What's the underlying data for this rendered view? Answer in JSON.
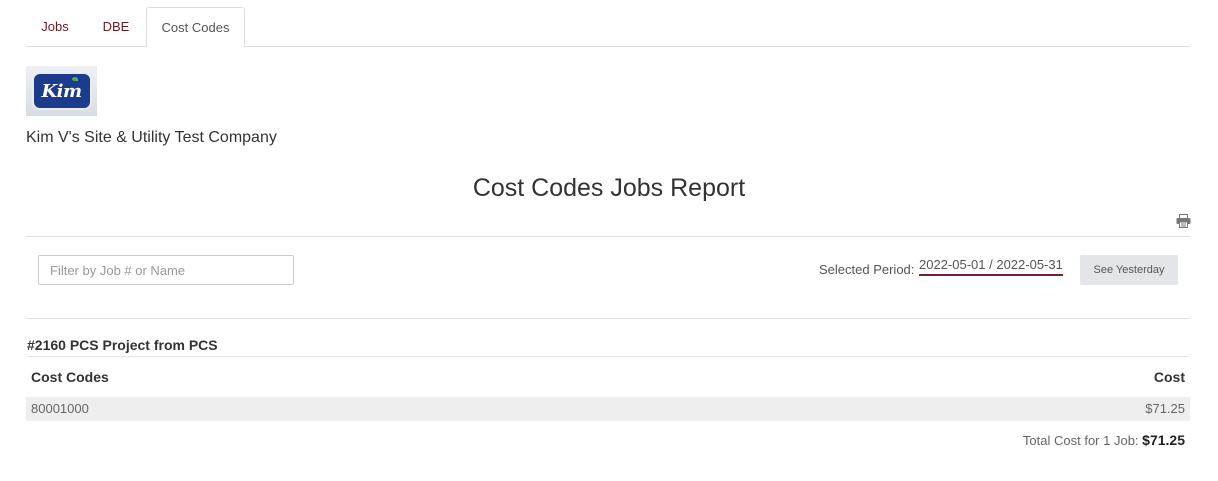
{
  "tabs": [
    {
      "label": "Jobs"
    },
    {
      "label": "DBE"
    },
    {
      "label": "Cost Codes"
    }
  ],
  "active_tab": "Cost Codes",
  "company": {
    "logo_text": "Kim",
    "name": "Kim V's Site & Utility Test Company"
  },
  "report": {
    "title": "Cost Codes Jobs Report"
  },
  "filter": {
    "placeholder": "Filter by Job # or Name",
    "value": ""
  },
  "period": {
    "label": "Selected Period:",
    "value": "2022-05-01 / 2022-05-31",
    "yesterday_button": "See Yesterday"
  },
  "jobs": [
    {
      "title": "#2160 PCS Project from PCS",
      "columns": [
        "Cost Codes",
        "Cost"
      ],
      "rows": [
        {
          "code": "80001000",
          "cost": "$71.25"
        }
      ]
    }
  ],
  "total": {
    "label": "Total Cost for 1 Job:",
    "value": "$71.25"
  },
  "colors": {
    "accent": "#6b1a24",
    "underline": "#7a1f2b",
    "logo_blue": "#1b3b8c",
    "row_bg": "#eeeeee"
  },
  "icons": {
    "print": "print-icon"
  }
}
